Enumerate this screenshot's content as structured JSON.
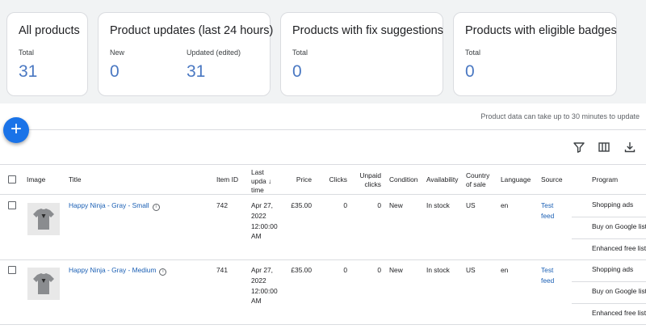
{
  "cards": [
    {
      "title": "All products",
      "metrics": [
        {
          "label": "Total",
          "value": "31"
        }
      ]
    },
    {
      "title": "Product updates (last 24 hours)",
      "metrics": [
        {
          "label": "New",
          "value": "0"
        },
        {
          "label": "Updated (edited)",
          "value": "31"
        }
      ]
    },
    {
      "title": "Products with fix suggestions",
      "metrics": [
        {
          "label": "Total",
          "value": "0"
        }
      ]
    },
    {
      "title": "Products with eligible badges",
      "metrics": [
        {
          "label": "Total",
          "value": "0"
        }
      ]
    }
  ],
  "notice": "Product data can take up to 30 minutes to update",
  "add_button": {
    "label": "+"
  },
  "toolbar": {
    "filter_icon": "filter-icon",
    "columns_icon": "columns-icon",
    "download_icon": "download-icon"
  },
  "table": {
    "headers": {
      "image": "Image",
      "title": "Title",
      "item_id": "Item ID",
      "last_update_1": "Last",
      "last_update_2": "upda",
      "last_update_3": "time",
      "price": "Price",
      "clicks": "Clicks",
      "unpaid_1": "Unpaid",
      "unpaid_2": "clicks",
      "condition": "Condition",
      "availability": "Availability",
      "country_1": "Country",
      "country_2": "of sale",
      "language": "Language",
      "source": "Source",
      "program": "Program"
    },
    "rows": [
      {
        "title": "Happy Ninja - Gray - Small",
        "item_id": "742",
        "date_1": "Apr 27,",
        "date_2": "2022",
        "date_3": "12:00:00",
        "date_4": "AM",
        "price": "£35.00",
        "clicks": "0",
        "unpaid_clicks": "0",
        "condition": "New",
        "availability": "In stock",
        "country": "US",
        "language": "en",
        "source_1": "Test",
        "source_2": "feed",
        "programs": [
          "Shopping ads",
          "Buy on Google listin",
          "Enhanced free listin"
        ]
      },
      {
        "title": "Happy Ninja - Gray - Medium",
        "item_id": "741",
        "date_1": "Apr 27,",
        "date_2": "2022",
        "date_3": "12:00:00",
        "date_4": "AM",
        "price": "£35.00",
        "clicks": "0",
        "unpaid_clicks": "0",
        "condition": "New",
        "availability": "In stock",
        "country": "US",
        "language": "en",
        "source_1": "Test",
        "source_2": "feed",
        "programs": [
          "Shopping ads",
          "Buy on Google listin",
          "Enhanced free listin"
        ]
      }
    ]
  },
  "colors": {
    "accent": "#1a73e8",
    "metric": "#4a78c2",
    "link": "#1a5fb4"
  }
}
